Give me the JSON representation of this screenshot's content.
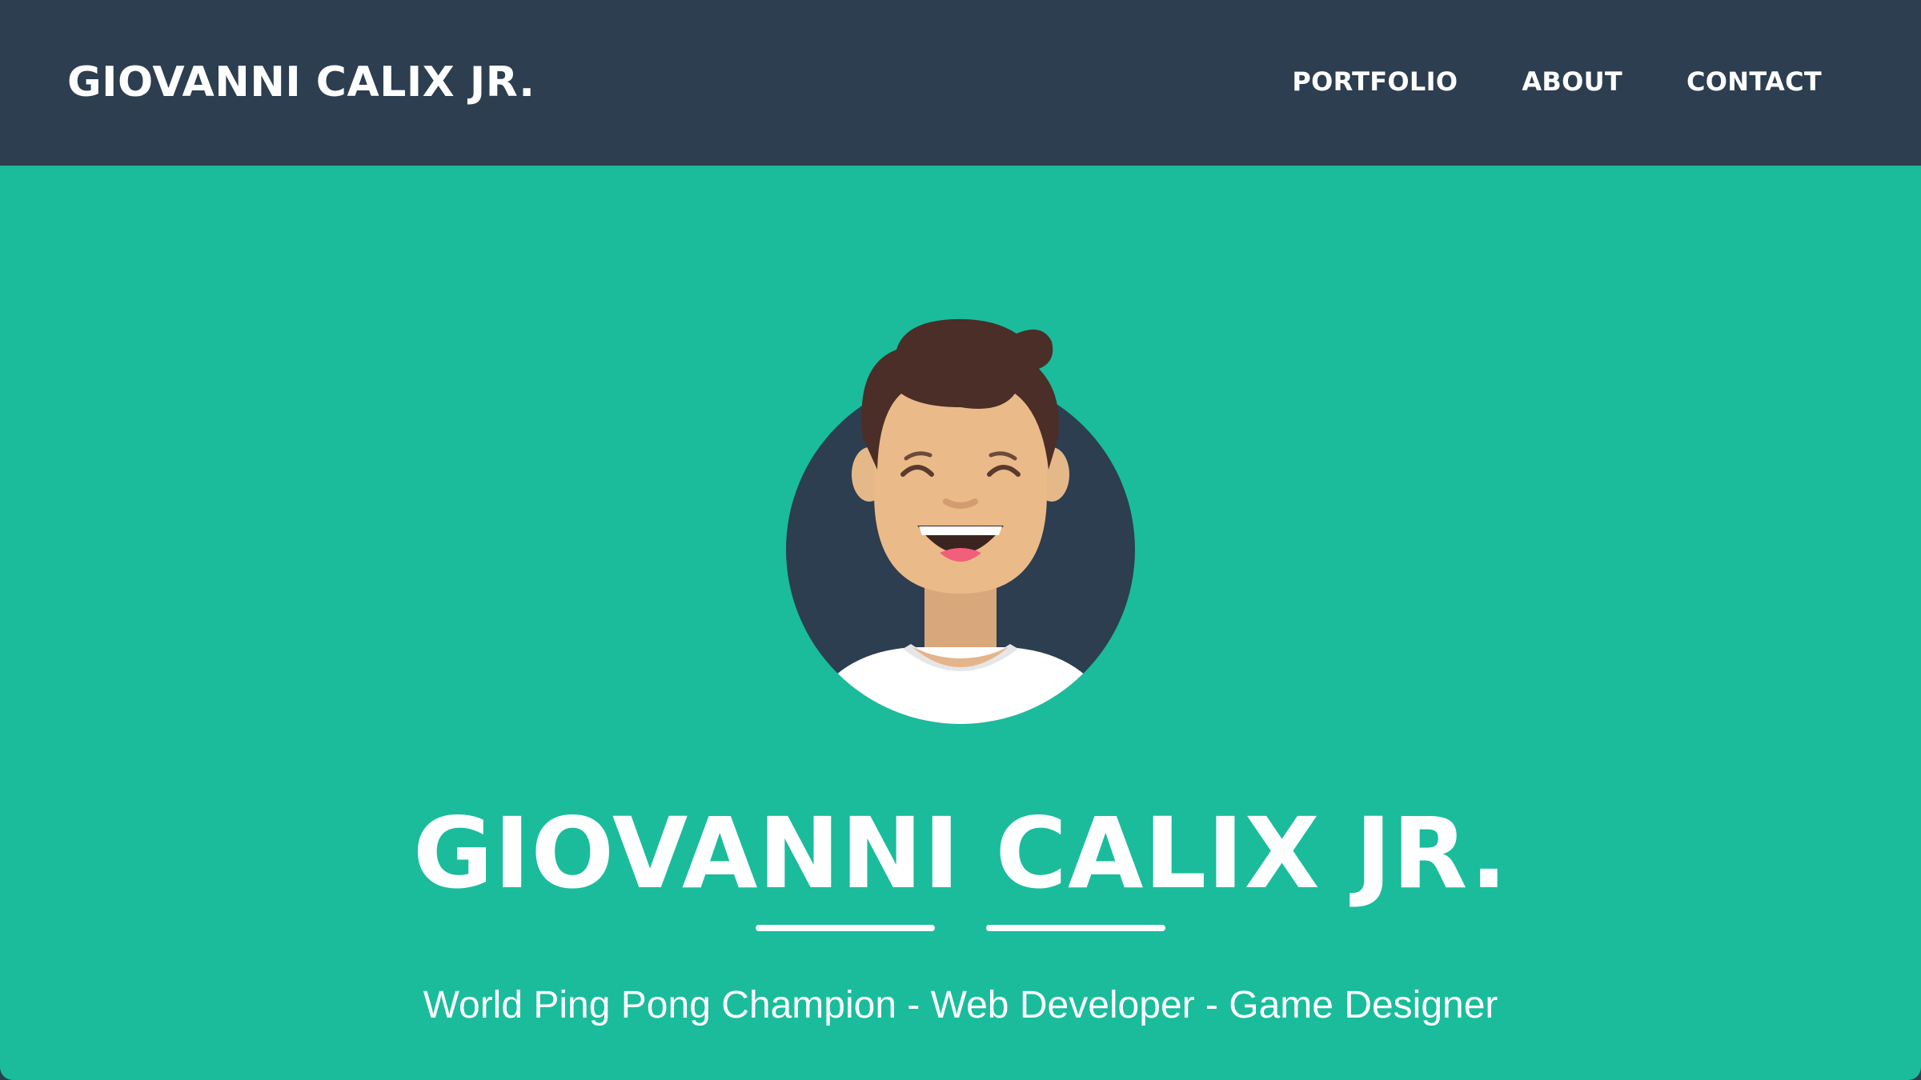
{
  "nav": {
    "brand": "GIOVANNI CALIX JR.",
    "links": [
      {
        "label": "PORTFOLIO"
      },
      {
        "label": "ABOUT"
      },
      {
        "label": "CONTACT"
      }
    ]
  },
  "hero": {
    "avatar_icon": "avatar-illustration",
    "title": "GIOVANNI CALIX JR.",
    "subtitle": "World Ping Pong Champion - Web Developer - Game Designer"
  },
  "colors": {
    "nav_background": "#2c3e50",
    "hero_background": "#1abc9c",
    "text": "#ffffff"
  }
}
